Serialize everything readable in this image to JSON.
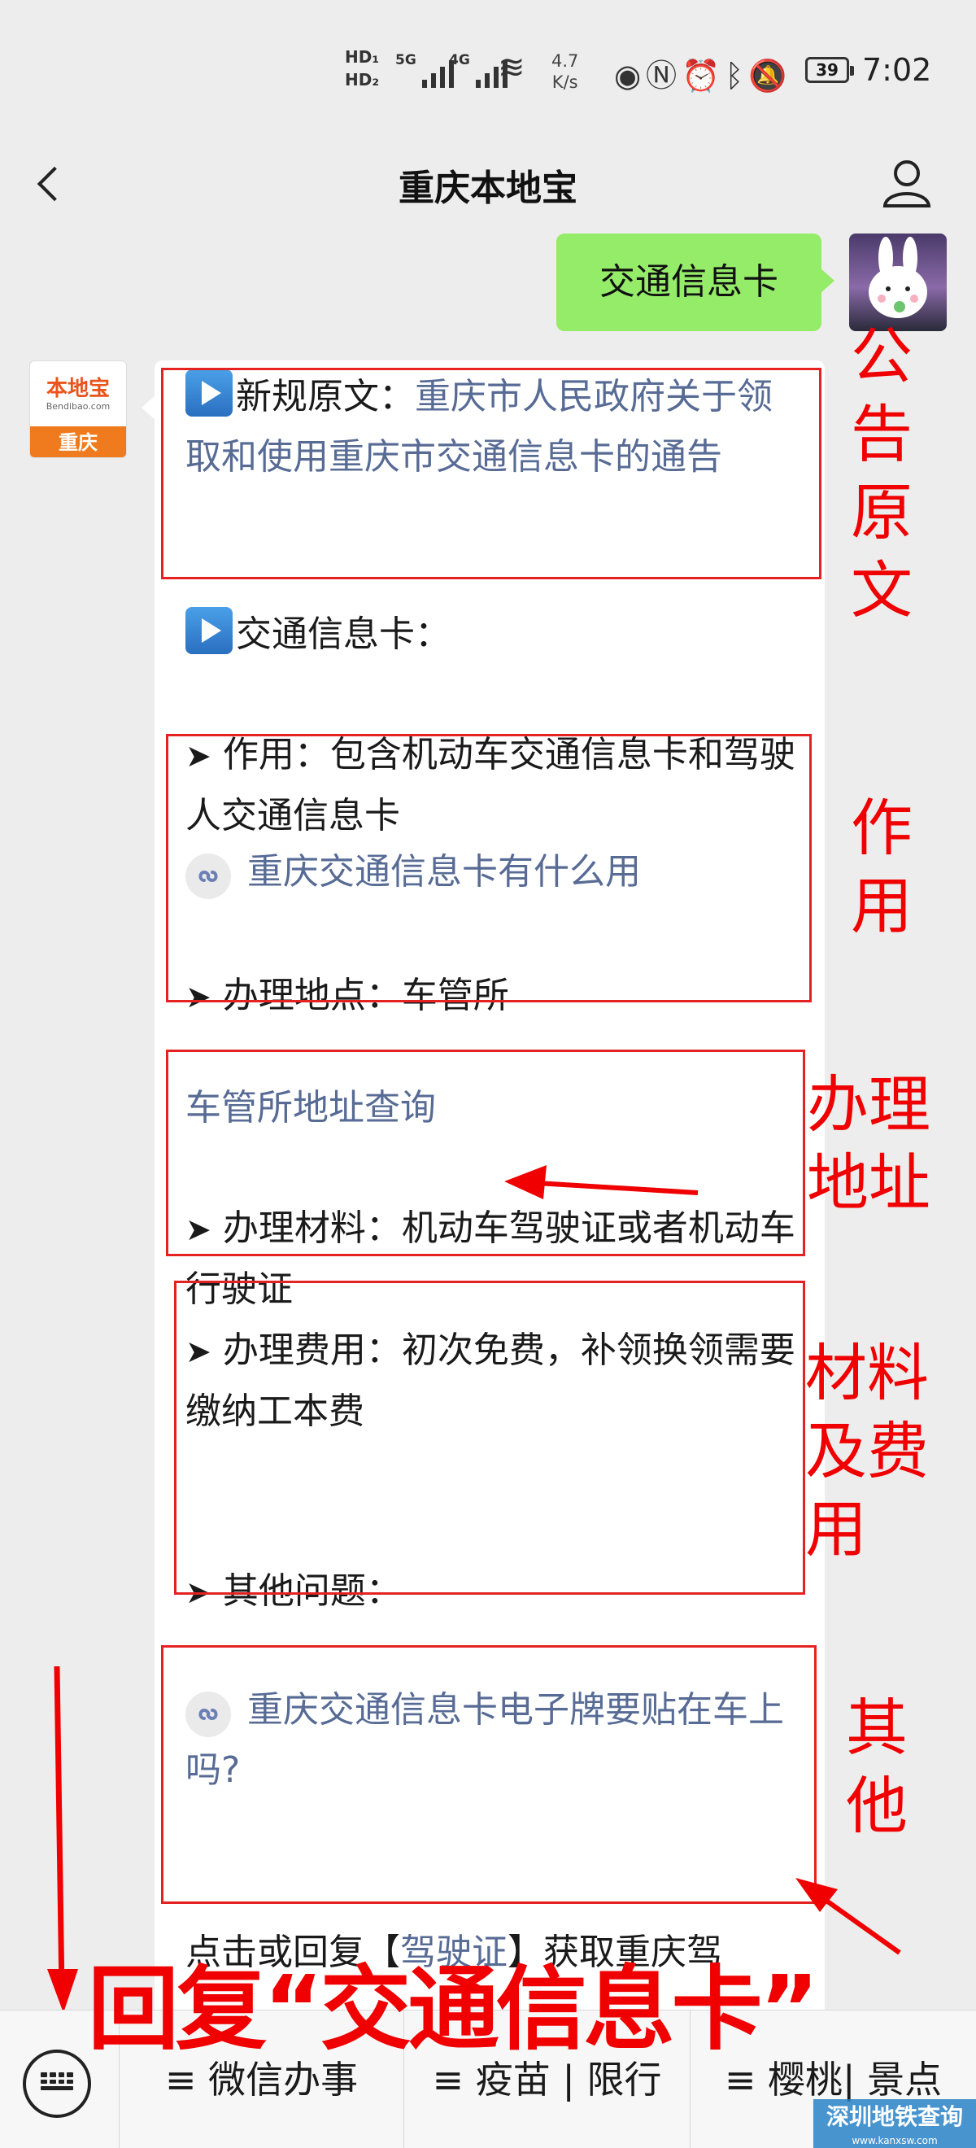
{
  "status_bar": {
    "hd1": "HD",
    "hd2": "HD",
    "net1": "5G",
    "net2": "4G",
    "speed_value": "4.7",
    "speed_unit": "K/s",
    "battery": "39",
    "time": "7:02",
    "icons": [
      "eye-icon",
      "nfc-icon",
      "alarm-icon",
      "bluetooth-icon",
      "mute-icon"
    ]
  },
  "nav": {
    "title": "重庆本地宝"
  },
  "chat": {
    "user_message": "交通信息卡",
    "bot_avatar": {
      "brand": "本地宝",
      "domain": "Bendibao.com",
      "city": "重庆"
    },
    "bot_message": {
      "p1_prefix": "新规原文：",
      "p1_link": "重庆市人民政府关于领取和使用重庆市交通信息卡的通告",
      "p2": "交通信息卡：",
      "p3": "作用：包含机动车交通信息卡和驾驶人交通信息卡",
      "p3_miniprogram": "重庆交通信息卡有什么用",
      "p4": "办理地点：车管所",
      "p4_link": "车管所地址查询",
      "p5": "办理材料：机动车驾驶证或者机动车行驶证",
      "p6": "办理费用：初次免费，补领换领需要缴纳工本费",
      "p7": "其他问题：",
      "p7_miniprogram": "重庆交通信息卡电子牌要贴在车上吗?",
      "p8_before": "点击或回复【",
      "p8_link": "驾驶证",
      "p8_after": "】获取重庆驾"
    }
  },
  "annotations": {
    "a1": "公告原文",
    "a2": "作用",
    "a3": "办理地址",
    "a4": "材料及费用",
    "a5": "其他",
    "bottom": "回复“交通信息卡”"
  },
  "bottom_menu": {
    "items": [
      "≡ 微信办事",
      "≡ 疫苗 | 限行",
      "≡ 樱桃| 景点"
    ]
  },
  "watermark": {
    "title": "深圳地铁查询",
    "domain": "www.kanxsw.com"
  },
  "colors": {
    "annotation_red": "#f00000",
    "bubble_green": "#95ec69",
    "link_blue": "#576b95"
  }
}
